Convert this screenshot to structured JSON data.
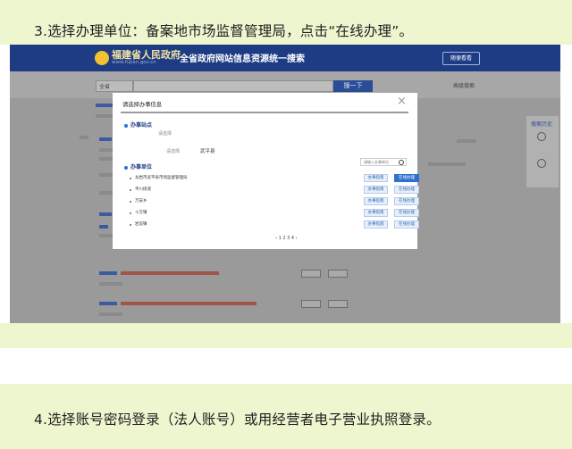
{
  "steps": [
    {
      "text": "3.选择办理单位：备案地市场监督管理局，点击“在线办理”。"
    },
    {
      "text": "4.选择账号密码登录（法人账号）或用经营者电子营业执照登录。"
    }
  ],
  "site": {
    "logo_name": "福建省人民政府",
    "logo_url": "www.fujian.gov.cn",
    "header_title": "全省政府网站信息资源统一搜索",
    "header_button": "随便看看",
    "scope_select": "全省",
    "search_placeholder": "",
    "search_button": "搜一下",
    "right_link": "高级搜索"
  },
  "side_panel": {
    "title": "搜索历史"
  },
  "modal": {
    "title": "请选择办事信息",
    "section_location": "办事站点",
    "location_hint": "请选择",
    "location_tabs": [
      "请选择",
      "武平县"
    ],
    "section_unit": "办事单位",
    "unit_search_placeholder": "请输入办事单位",
    "units": [
      {
        "name": "龙岩市武平县市场监督管理局",
        "guide": "办事指南",
        "online": "在线办理",
        "primary": true
      },
      {
        "name": "平川街道",
        "guide": "办事指南",
        "online": "在线办理",
        "primary": false
      },
      {
        "name": "万安乡",
        "guide": "办事指南",
        "online": "在线办理",
        "primary": false
      },
      {
        "name": "十方镇",
        "guide": "办事指南",
        "online": "在线办理",
        "primary": false
      },
      {
        "name": "岩前镇",
        "guide": "办事指南",
        "online": "在线办理",
        "primary": false
      }
    ],
    "pager": "‹ 1 2 3 4 ›"
  }
}
